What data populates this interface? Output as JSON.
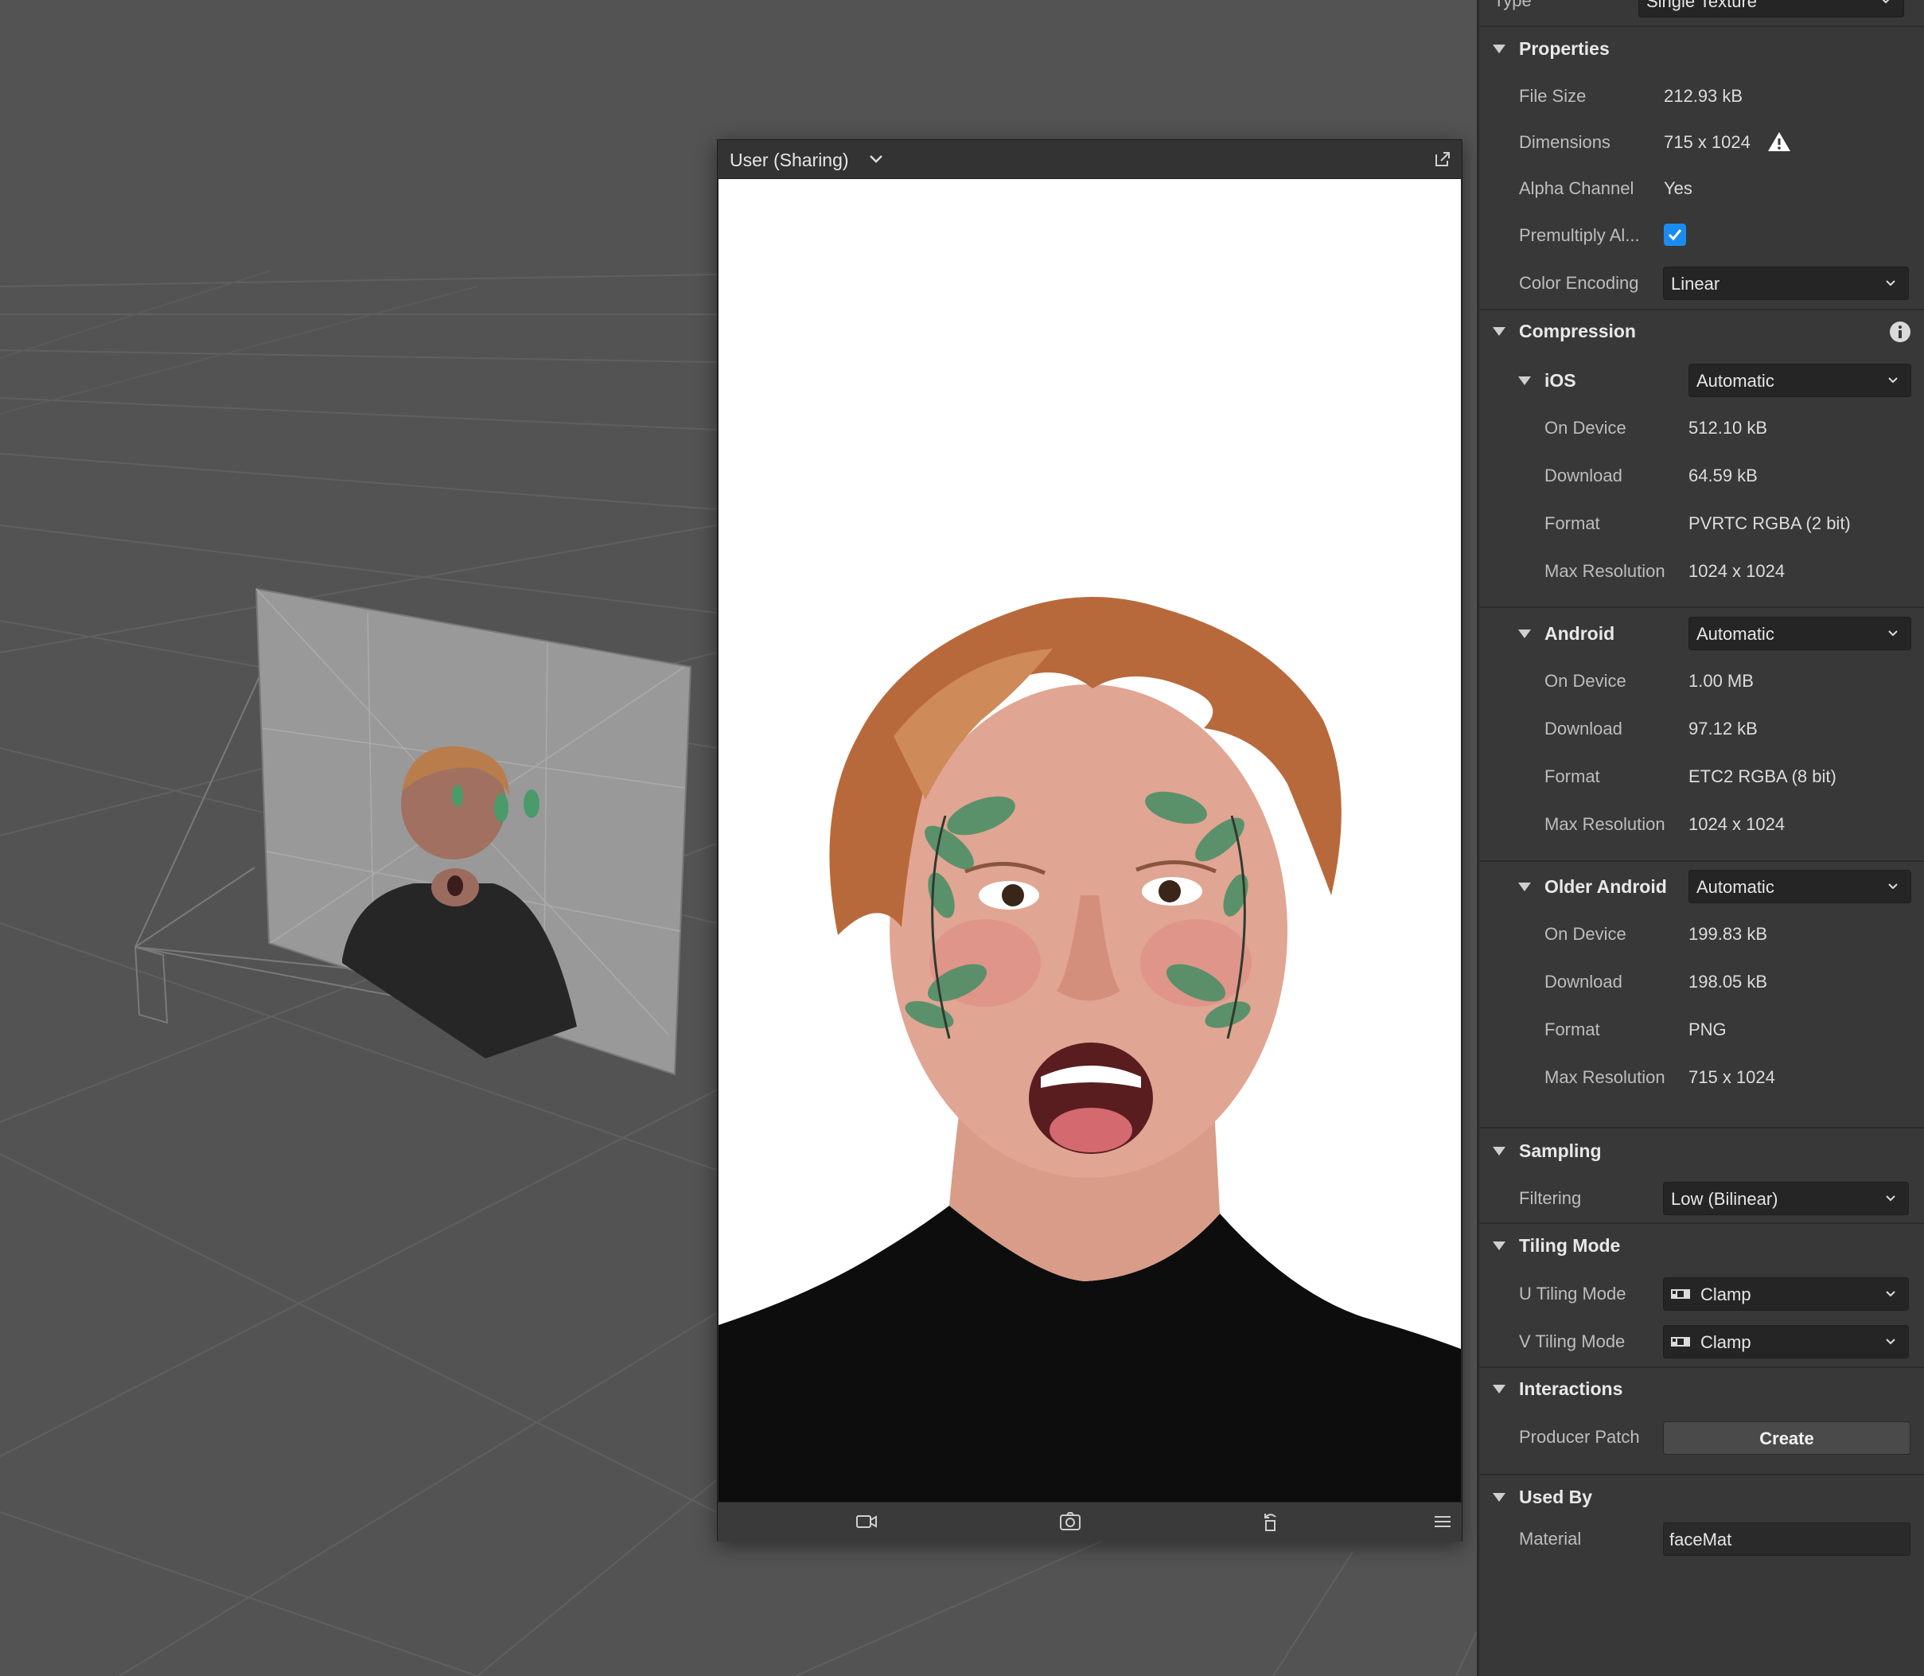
{
  "simulator": {
    "title": "User (Sharing)",
    "icons": {
      "dropdown": "chevron-down-icon",
      "popout": "popout-icon",
      "footer": [
        "video-camera-icon",
        "flip-camera-icon",
        "rotate-icon",
        "menu-icon"
      ]
    }
  },
  "inspector": {
    "type": {
      "label": "Type",
      "value": "Single Texture"
    },
    "properties": {
      "title": "Properties",
      "file_size": {
        "label": "File Size",
        "value": "212.93 kB"
      },
      "dimensions": {
        "label": "Dimensions",
        "value": "715 x 1024",
        "icon": "warning-icon"
      },
      "alpha": {
        "label": "Alpha Channel",
        "value": "Yes"
      },
      "premultiply": {
        "label": "Premultiply Al...",
        "checked": true
      },
      "color_encoding": {
        "label": "Color Encoding",
        "value": "Linear"
      }
    },
    "compression": {
      "title": "Compression",
      "icon": "info-icon",
      "ios": {
        "title": "iOS",
        "mode": "Automatic",
        "on_device": {
          "label": "On Device",
          "value": "512.10 kB"
        },
        "download": {
          "label": "Download",
          "value": "64.59 kB"
        },
        "format": {
          "label": "Format",
          "value": "PVRTC RGBA (2 bit)"
        },
        "max_res": {
          "label": "Max Resolution",
          "value": "1024 x 1024"
        }
      },
      "android": {
        "title": "Android",
        "mode": "Automatic",
        "on_device": {
          "label": "On Device",
          "value": "1.00 MB"
        },
        "download": {
          "label": "Download",
          "value": "97.12 kB"
        },
        "format": {
          "label": "Format",
          "value": "ETC2 RGBA (8 bit)"
        },
        "max_res": {
          "label": "Max Resolution",
          "value": "1024 x 1024"
        }
      },
      "older_android": {
        "title": "Older Android",
        "mode": "Automatic",
        "on_device": {
          "label": "On Device",
          "value": "199.83 kB"
        },
        "download": {
          "label": "Download",
          "value": "198.05 kB"
        },
        "format": {
          "label": "Format",
          "value": "PNG"
        },
        "max_res": {
          "label": "Max Resolution",
          "value": "715 x 1024"
        }
      }
    },
    "sampling": {
      "title": "Sampling",
      "filtering": {
        "label": "Filtering",
        "value": "Low (Bilinear)"
      }
    },
    "tiling": {
      "title": "Tiling Mode",
      "u": {
        "label": "U Tiling Mode",
        "value": "Clamp"
      },
      "v": {
        "label": "V Tiling Mode",
        "value": "Clamp"
      }
    },
    "interactions": {
      "title": "Interactions",
      "producer": {
        "label": "Producer Patch",
        "button": "Create"
      }
    },
    "used_by": {
      "title": "Used By",
      "material": {
        "label": "Material",
        "value": "faceMat"
      }
    }
  }
}
